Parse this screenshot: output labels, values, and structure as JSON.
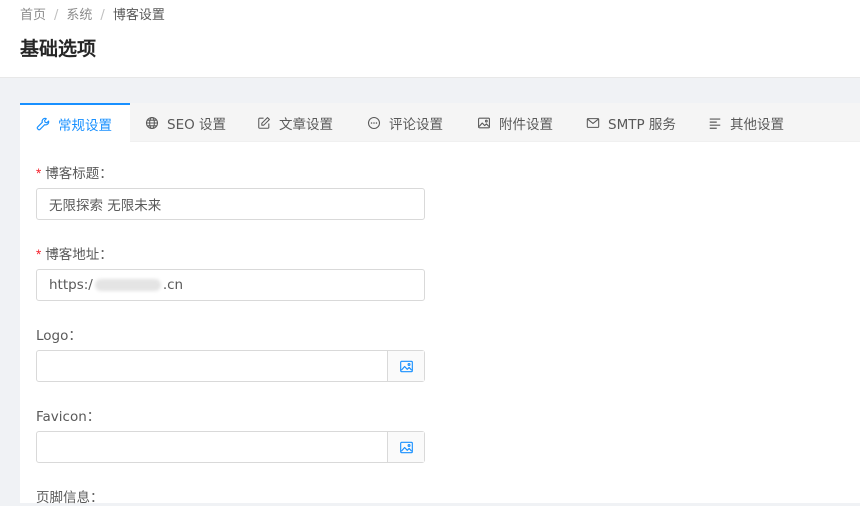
{
  "breadcrumb": {
    "items": [
      "首页",
      "系统",
      "博客设置"
    ],
    "separator": "/"
  },
  "page_title": "基础选项",
  "tabs": [
    {
      "label": "常规设置",
      "icon": "wrench-icon",
      "active": true
    },
    {
      "label": "SEO 设置",
      "icon": "globe-icon",
      "active": false
    },
    {
      "label": "文章设置",
      "icon": "edit-icon",
      "active": false
    },
    {
      "label": "评论设置",
      "icon": "comment-icon",
      "active": false
    },
    {
      "label": "附件设置",
      "icon": "image-icon",
      "active": false
    },
    {
      "label": "SMTP 服务",
      "icon": "mail-icon",
      "active": false
    },
    {
      "label": "其他设置",
      "icon": "align-left-icon",
      "active": false
    }
  ],
  "form": {
    "required_mark": "*",
    "blog_title": {
      "label": "博客标题：",
      "value": "无限探索 无限未来"
    },
    "blog_url": {
      "label": "博客地址：",
      "value_prefix": "https:/",
      "value_suffix": ".cn"
    },
    "logo": {
      "label": "Logo：",
      "value": "",
      "picker_icon": "image-picker-icon"
    },
    "favicon": {
      "label": "Favicon：",
      "value": "",
      "picker_icon": "image-picker-icon"
    },
    "footer": {
      "label": "页脚信息："
    }
  },
  "colors": {
    "accent": "#1890ff",
    "required": "#f5222d",
    "background": "#f0f2f5"
  }
}
